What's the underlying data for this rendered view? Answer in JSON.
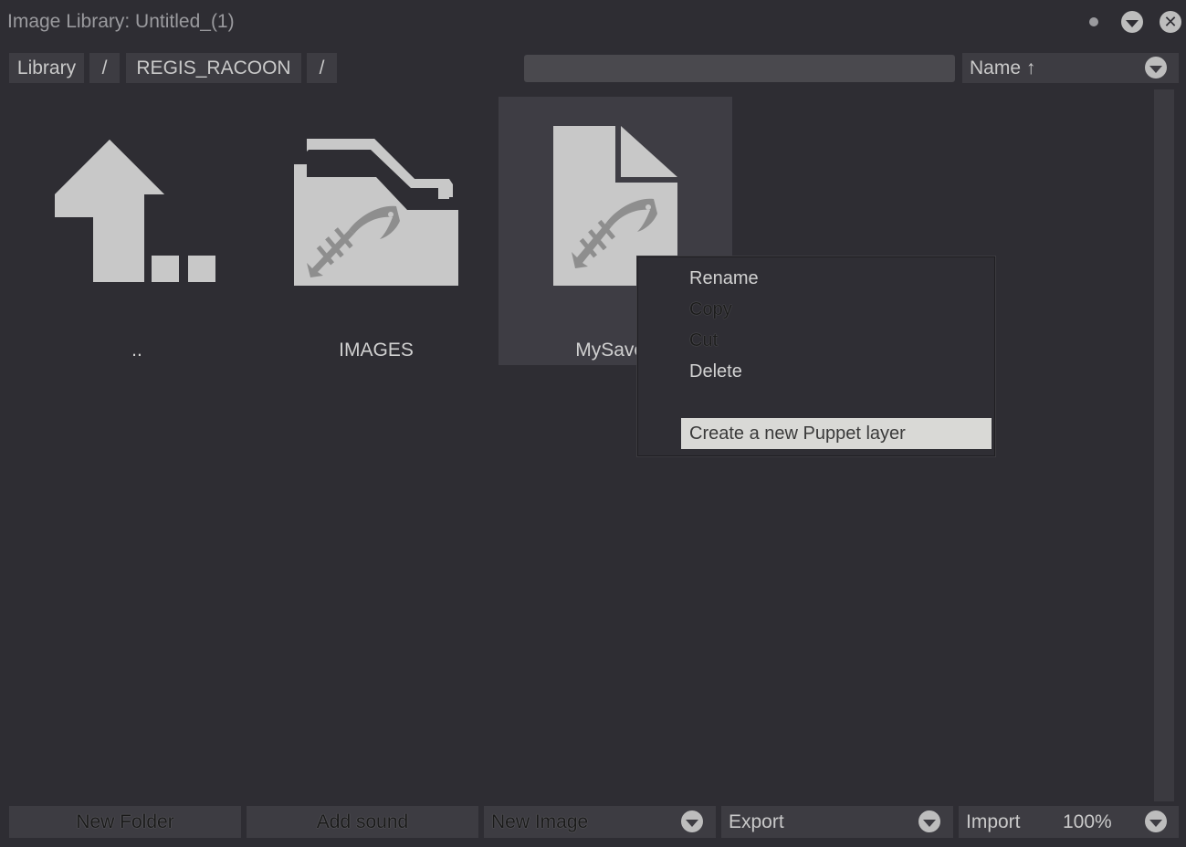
{
  "window": {
    "title": "Image Library: Untitled_(1)"
  },
  "breadcrumb": {
    "items": [
      "Library",
      "/",
      "REGIS_RACOON",
      "/"
    ]
  },
  "search": {
    "value": ""
  },
  "sort": {
    "label": "Name ↑"
  },
  "items": [
    {
      "label": "..",
      "icon": "parent-folder-icon"
    },
    {
      "label": "IMAGES",
      "icon": "folder-icon"
    },
    {
      "label": "MySaved",
      "icon": "document-icon"
    }
  ],
  "context_menu": {
    "items": [
      "Rename",
      "Copy",
      "Cut",
      "Delete"
    ],
    "highlighted": "Create a new Puppet layer"
  },
  "footer": {
    "new_folder": "New Folder",
    "add_sound": "Add sound",
    "new_image": "New Image",
    "export": "Export",
    "import": "Import",
    "zoom": "100%"
  }
}
